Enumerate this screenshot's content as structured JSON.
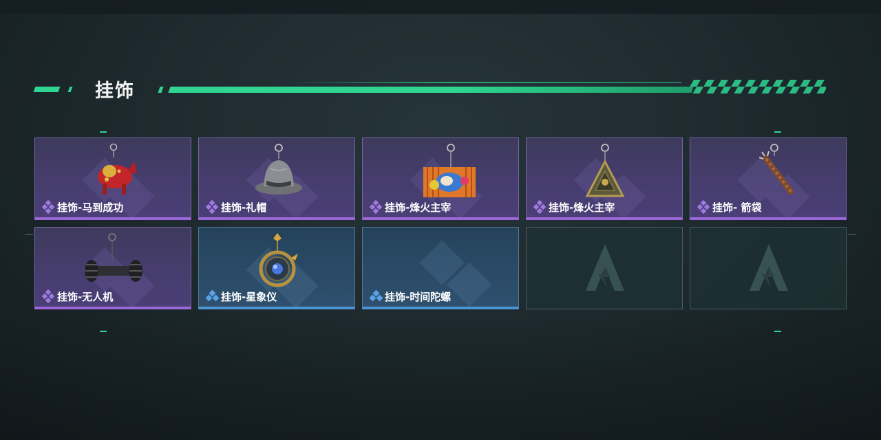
{
  "section": {
    "title": "挂饰"
  },
  "colors": {
    "accent": "#2fd591",
    "purple_rarity": "#9a66d8",
    "blue_rarity": "#4d94d2"
  },
  "items": [
    {
      "name": "挂饰-马到成功",
      "rarity": "purple",
      "icon": "red-horse-charm-icon"
    },
    {
      "name": "挂饰-礼帽",
      "rarity": "purple",
      "icon": "fedora-hat-charm-icon"
    },
    {
      "name": "挂饰-烽火主宰",
      "rarity": "purple",
      "icon": "graffiti-container-charm-icon"
    },
    {
      "name": "挂饰-烽火主宰",
      "rarity": "purple",
      "icon": "triangle-pendant-charm-icon"
    },
    {
      "name": "挂饰- 箭袋",
      "rarity": "purple",
      "icon": "quiver-charm-icon"
    },
    {
      "name": "挂饰-无人机",
      "rarity": "purple",
      "icon": "drone-roller-charm-icon"
    },
    {
      "name": "挂饰-星象仪",
      "rarity": "blue",
      "icon": "astrolabe-charm-icon"
    },
    {
      "name": "挂饰-时间陀螺",
      "rarity": "blue",
      "icon": "none"
    },
    {
      "name": "",
      "rarity": "empty",
      "icon": "empty-slot-logo-icon"
    },
    {
      "name": "",
      "rarity": "empty",
      "icon": "empty-slot-logo-icon"
    }
  ]
}
